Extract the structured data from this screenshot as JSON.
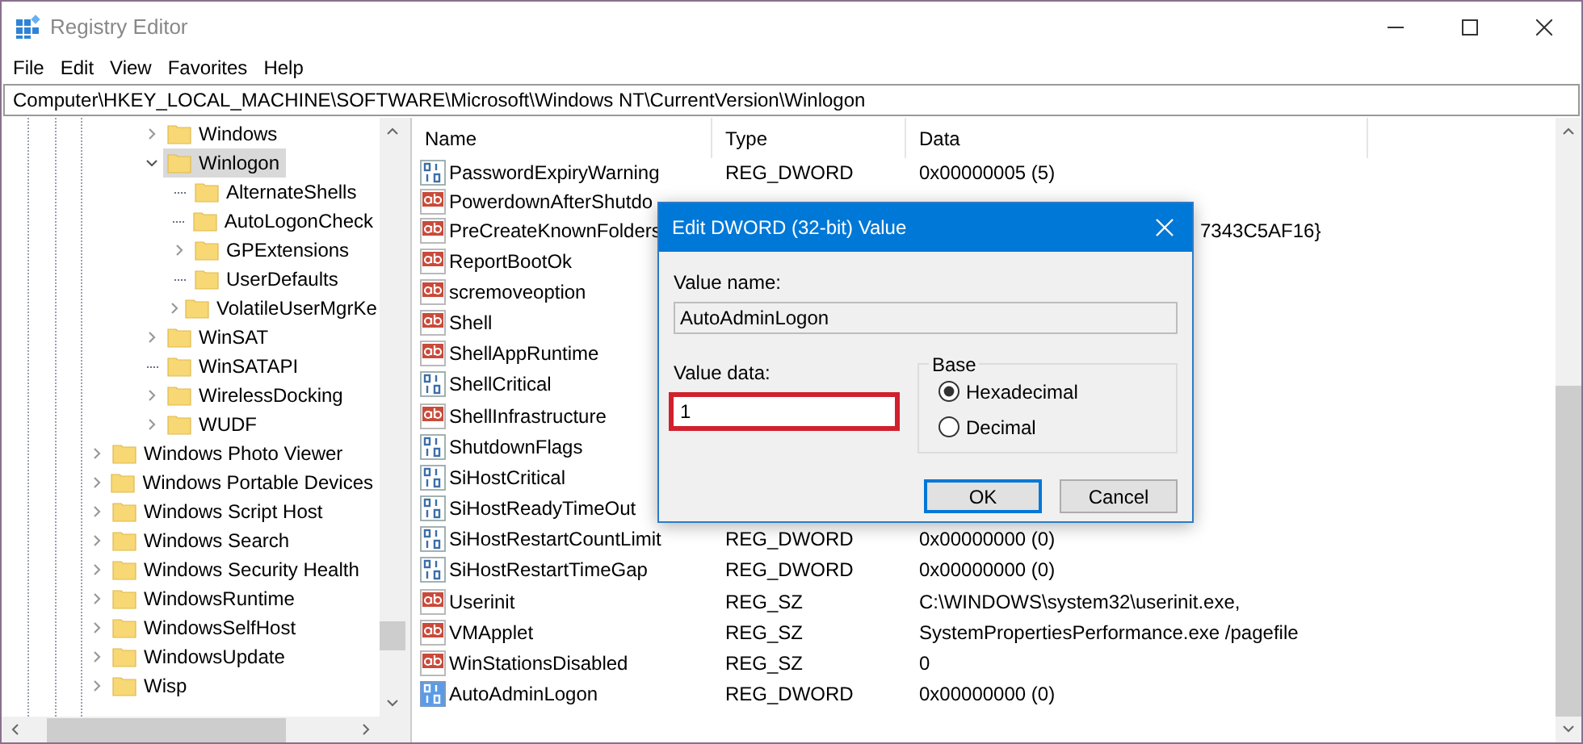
{
  "window": {
    "title": "Registry Editor"
  },
  "menu": [
    "File",
    "Edit",
    "View",
    "Favorites",
    "Help"
  ],
  "address": "Computer\\HKEY_LOCAL_MACHINE\\SOFTWARE\\Microsoft\\Windows NT\\CurrentVersion\\Winlogon",
  "tree": {
    "items": [
      {
        "children": [
          {
            "children": [
              {
                "label": "Windows",
                "expanded": false,
                "selected": false
              },
              {
                "label": "Winlogon",
                "expanded": true,
                "selected": true,
                "children": [
                  {
                    "label": "AlternateShells",
                    "selected": false
                  },
                  {
                    "label": "AutoLogonCheck",
                    "selected": false
                  },
                  {
                    "label": "GPExtensions",
                    "expanded": false,
                    "selected": false
                  },
                  {
                    "label": "UserDefaults",
                    "selected": false
                  },
                  {
                    "label": "VolatileUserMgrKe",
                    "expanded": false,
                    "selected": false
                  }
                ]
              },
              {
                "label": "WinSAT",
                "expanded": false,
                "selected": false
              },
              {
                "label": "WinSATAPI",
                "selected": false
              },
              {
                "label": "WirelessDocking",
                "expanded": false,
                "selected": false
              },
              {
                "label": "WUDF",
                "expanded": false,
                "selected": false
              }
            ]
          }
        ]
      },
      {
        "label": "Windows Photo Viewer",
        "expanded": false,
        "selected": false
      },
      {
        "label": "Windows Portable Devices",
        "expanded": false,
        "selected": false
      },
      {
        "label": "Windows Script Host",
        "expanded": false,
        "selected": false
      },
      {
        "label": "Windows Search",
        "expanded": false,
        "selected": false
      },
      {
        "label": "Windows Security Health",
        "expanded": false,
        "selected": false
      },
      {
        "label": "WindowsRuntime",
        "expanded": false,
        "selected": false
      },
      {
        "label": "WindowsSelfHost",
        "expanded": false,
        "selected": false
      },
      {
        "label": "WindowsUpdate",
        "expanded": false,
        "selected": false
      },
      {
        "label": "Wisp",
        "expanded": false,
        "selected": false
      }
    ]
  },
  "table": {
    "columns": [
      "Name",
      "Type",
      "Data"
    ],
    "rows": [
      {
        "kind": "binary",
        "name": "PasswordExpiryWarning",
        "type": "REG_DWORD",
        "data": "0x00000005 (5)",
        "selected": false
      },
      {
        "kind": "string",
        "name": "PowerdownAfterShutdo",
        "selected": false
      },
      {
        "kind": "string",
        "name": "PreCreateKnownFolders",
        "data": "7343C5AF16}",
        "data_behind_dialog": true,
        "selected": false
      },
      {
        "kind": "string",
        "name": "ReportBootOk",
        "selected": false
      },
      {
        "kind": "string",
        "name": "scremoveoption",
        "selected": false
      },
      {
        "kind": "string",
        "name": "Shell",
        "selected": false
      },
      {
        "kind": "string",
        "name": "ShellAppRuntime",
        "selected": false
      },
      {
        "kind": "binary",
        "name": "ShellCritical",
        "selected": false
      },
      {
        "kind": "string",
        "name": "ShellInfrastructure",
        "selected": false
      },
      {
        "kind": "binary",
        "name": "ShutdownFlags",
        "selected": false
      },
      {
        "kind": "binary",
        "name": "SiHostCritical",
        "selected": false
      },
      {
        "kind": "binary",
        "name": "SiHostReadyTimeOut",
        "selected": false
      },
      {
        "kind": "binary",
        "name": "SiHostRestartCountLimit",
        "type": "REG_DWORD",
        "data": "0x00000000 (0)",
        "selected": false
      },
      {
        "kind": "binary",
        "name": "SiHostRestartTimeGap",
        "type": "REG_DWORD",
        "data": "0x00000000 (0)",
        "selected": false
      },
      {
        "kind": "string",
        "name": "Userinit",
        "type": "REG_SZ",
        "data": "C:\\WINDOWS\\system32\\userinit.exe,",
        "selected": false
      },
      {
        "kind": "string",
        "name": "VMApplet",
        "type": "REG_SZ",
        "data": "SystemPropertiesPerformance.exe /pagefile",
        "selected": false
      },
      {
        "kind": "string",
        "name": "WinStationsDisabled",
        "type": "REG_SZ",
        "data": "0",
        "selected": false
      },
      {
        "kind": "binary",
        "name": "AutoAdminLogon",
        "type": "REG_DWORD",
        "data": "0x00000000 (0)",
        "selected": true
      }
    ]
  },
  "dialog": {
    "title": "Edit DWORD (32-bit) Value",
    "value_name_label": "Value name:",
    "value_name": "AutoAdminLogon",
    "value_data_label": "Value data:",
    "value_data": "1",
    "value_data_highlighted": true,
    "base": {
      "label": "Base",
      "options": [
        {
          "label": "Hexadecimal",
          "selected": true
        },
        {
          "label": "Decimal",
          "selected": false
        }
      ]
    },
    "buttons": [
      {
        "label": "OK",
        "default": true
      },
      {
        "label": "Cancel",
        "default": false
      }
    ]
  }
}
